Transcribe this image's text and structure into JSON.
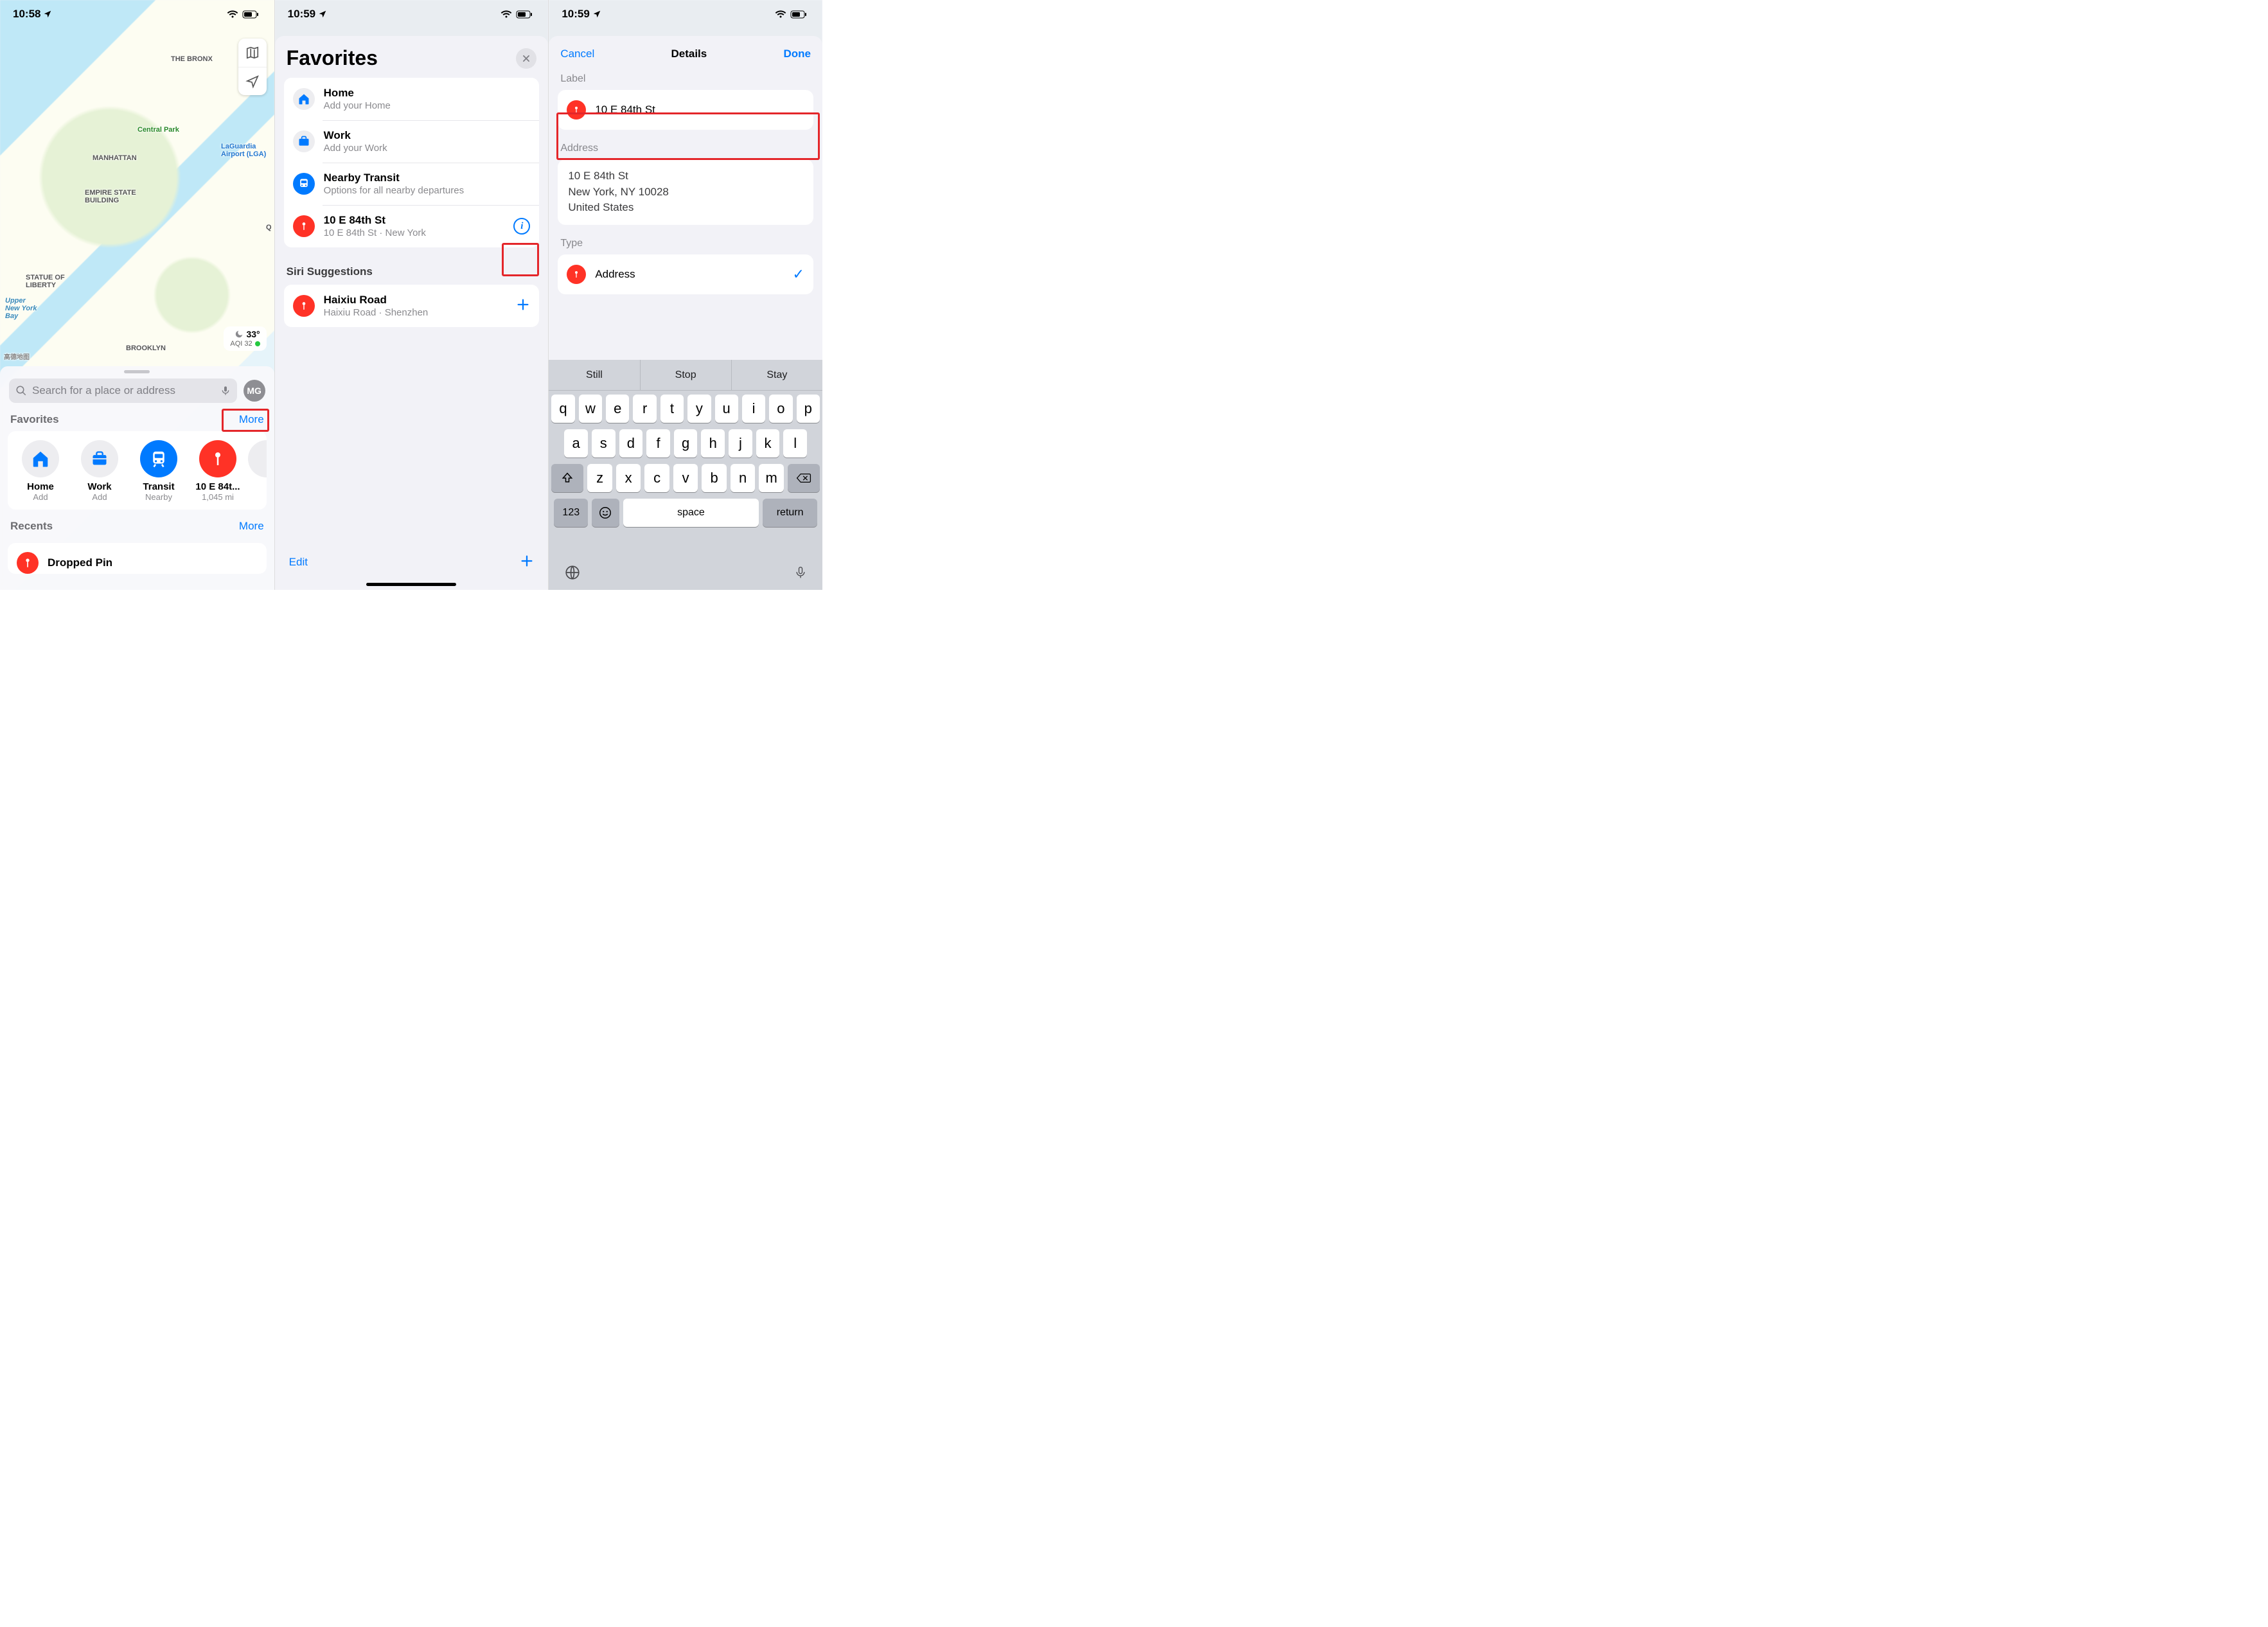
{
  "screen1": {
    "status": {
      "time": "10:58"
    },
    "map_labels": {
      "bronx": "THE BRONX",
      "central_park": "Central Park",
      "laguardia": "LaGuardia\nAirport (LGA)",
      "manhattan": "MANHATTAN",
      "empire": "EMPIRE STATE\nBUILDING",
      "liberty": "STATUE OF\nLIBERTY",
      "bay": "Upper\nNew York\nBay",
      "brooklyn": "BROOKLYN",
      "queens_initial": "Q",
      "attribution": "高德地图"
    },
    "weather": {
      "temp": "33°",
      "aqi_label": "AQI 32"
    },
    "search": {
      "placeholder": "Search for a place or address"
    },
    "avatar": "MG",
    "favorites_header": {
      "title": "Favorites",
      "more": "More"
    },
    "favorites": [
      {
        "name": "Home",
        "sub": "Add"
      },
      {
        "name": "Work",
        "sub": "Add"
      },
      {
        "name": "Transit",
        "sub": "Nearby"
      },
      {
        "name": "10 E 84t...",
        "sub": "1,045 mi"
      }
    ],
    "recents_header": {
      "title": "Recents",
      "more": "More"
    },
    "recents_first": "Dropped Pin"
  },
  "screen2": {
    "status": {
      "time": "10:59"
    },
    "title": "Favorites",
    "rows": [
      {
        "t1": "Home",
        "t2": "Add your Home"
      },
      {
        "t1": "Work",
        "t2": "Add your Work"
      },
      {
        "t1": "Nearby Transit",
        "t2": "Options for all nearby departures"
      },
      {
        "t1": "10 E 84th St",
        "t2": "10 E 84th St · New York"
      }
    ],
    "siri_header": "Siri Suggestions",
    "siri_row": {
      "t1": "Haixiu Road",
      "t2": "Haixiu Road · Shenzhen"
    },
    "toolbar": {
      "edit": "Edit"
    }
  },
  "screen3": {
    "status": {
      "time": "10:59"
    },
    "nav": {
      "cancel": "Cancel",
      "title": "Details",
      "done": "Done"
    },
    "label_group": "Label",
    "label_value": "10 E 84th St",
    "address_group": "Address",
    "address": {
      "line1": "10 E 84th St",
      "line2": "New York, NY  10028",
      "line3": "United States"
    },
    "type_group": "Type",
    "type_value": "Address",
    "keyboard": {
      "suggestions": [
        "Still",
        "Stop",
        "Stay"
      ],
      "row1": [
        "q",
        "w",
        "e",
        "r",
        "t",
        "y",
        "u",
        "i",
        "o",
        "p"
      ],
      "row2": [
        "a",
        "s",
        "d",
        "f",
        "g",
        "h",
        "j",
        "k",
        "l"
      ],
      "row3": [
        "z",
        "x",
        "c",
        "v",
        "b",
        "n",
        "m"
      ],
      "numkey": "123",
      "space": "space",
      "return": "return"
    }
  }
}
